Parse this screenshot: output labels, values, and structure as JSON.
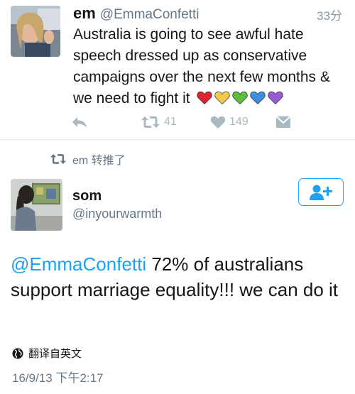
{
  "original_tweet": {
    "name": "em",
    "handle": "@EmmaConfetti",
    "time": "33分",
    "text": "Australia is going to see awful hate speech dressed up as conservative campaigns over the next few months & we need to fight it",
    "emoji_hearts": [
      "red-heart",
      "yellow-heart",
      "green-heart",
      "blue-heart",
      "purple-heart"
    ],
    "heart_colors": [
      "#e0242f",
      "#f7c948",
      "#5bbf3a",
      "#3b8fe0",
      "#9b5ad6"
    ],
    "actions": {
      "reply_icon": "reply-icon",
      "retweet_count": "41",
      "like_count": "149",
      "dm_icon": "direct-message-icon"
    }
  },
  "retweet_context": {
    "label": "em 转推了"
  },
  "retweeted_tweet": {
    "name": "som",
    "handle": "@inyourwarmth",
    "mention": "@EmmaConfetti",
    "body": " 72% of australians support marriage equality!!! we can do it",
    "translate_label": "翻译自英文",
    "timestamp": "16/9/13 下午2:17",
    "follow_icon": "follow-add-user-icon"
  },
  "colors": {
    "accent": "#1da1f2",
    "secondary_text": "#657786",
    "action_gray": "#aab8c2",
    "divider": "#e1e8ed"
  }
}
